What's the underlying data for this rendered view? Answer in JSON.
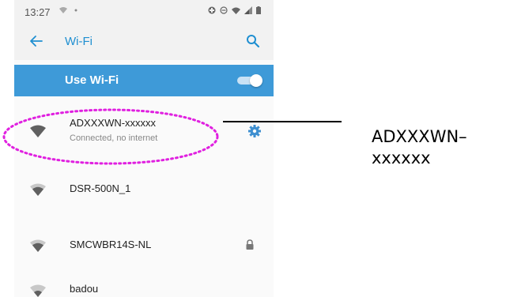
{
  "status_bar": {
    "time": "13:27",
    "left_icons": [
      "wifi-small-icon",
      "dot-icon"
    ],
    "right_icons": [
      "data-saver-icon",
      "dnd-icon",
      "wifi-signal-icon",
      "cell-signal-icon",
      "battery-icon"
    ]
  },
  "app_bar": {
    "title": "Wi-Fi",
    "back_icon": "arrow-left-icon",
    "search_icon": "search-icon",
    "accent_color": "#1f8fd1"
  },
  "wifi_toggle": {
    "label": "Use Wi-Fi",
    "state": "on",
    "bar_color": "#3e9ad8"
  },
  "networks": [
    {
      "name": "ADXXXWN-xxxxxx",
      "status": "Connected, no internet",
      "secured": false,
      "action_icon": "gear-icon"
    },
    {
      "name": "DSR-500N_1",
      "status": "",
      "secured": false
    },
    {
      "name": "SMCWBR14S-NL",
      "status": "",
      "secured": true,
      "action_icon": "lock-icon"
    },
    {
      "name": "badou",
      "status": "",
      "secured": false
    }
  ],
  "annotation": {
    "label_line1": "ADXXXWN–",
    "label_line2": "xxxxxx",
    "highlight_color": "#e020e0"
  }
}
